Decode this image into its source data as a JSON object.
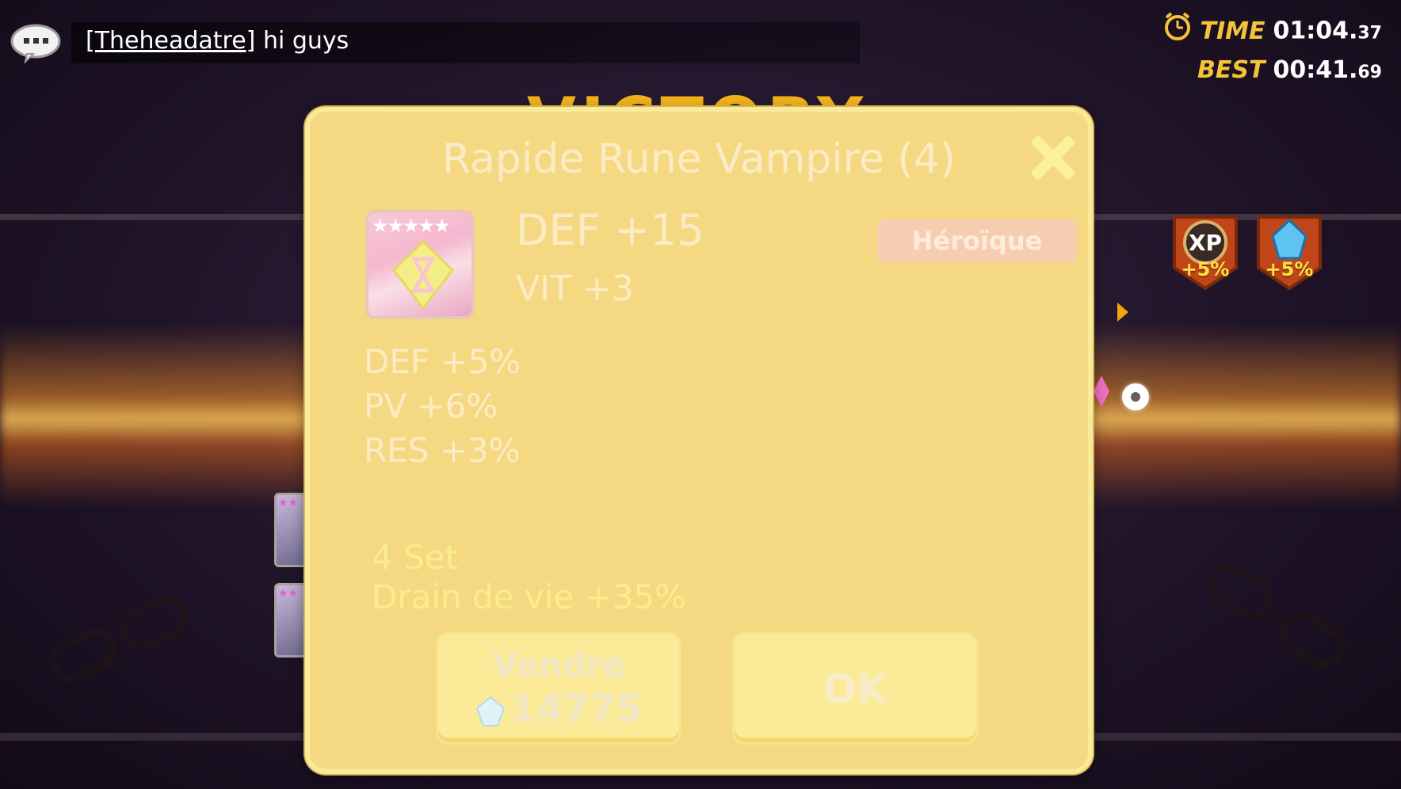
{
  "chat": {
    "user": "[Theheadatre]",
    "message": "hi guys"
  },
  "timer": {
    "time_label": "TIME",
    "time_value": "01:04.",
    "time_fraction": "37",
    "best_label": "BEST",
    "best_value": "00:41.",
    "best_fraction": "69"
  },
  "banner": {
    "text": "VICTORY"
  },
  "bonuses": [
    {
      "icon": "xp-badge-icon",
      "label": "XP",
      "value": "+5%"
    },
    {
      "icon": "crystal-badge-icon",
      "value": "+5%"
    }
  ],
  "rune": {
    "title": "Rapide Rune Vampire (4)",
    "stars": "★★★★★",
    "main_stat": "DEF +15",
    "prefix_stat": "VIT +3",
    "grade": "Héroïque",
    "substats": [
      "DEF +5%",
      "PV +6%",
      "RES +3%"
    ],
    "set_count": "4 Set",
    "set_effect": "Drain de vie +35%"
  },
  "actions": {
    "sell_label": "Vendre",
    "sell_price": "14775",
    "ok_label": "OK"
  },
  "colors": {
    "modal_bg": "#f4d982",
    "title_text": "#fcebc4",
    "set_text": "#fcec8c",
    "grade_bg": "#f7cdb1",
    "timer_label": "#f5c33a"
  }
}
